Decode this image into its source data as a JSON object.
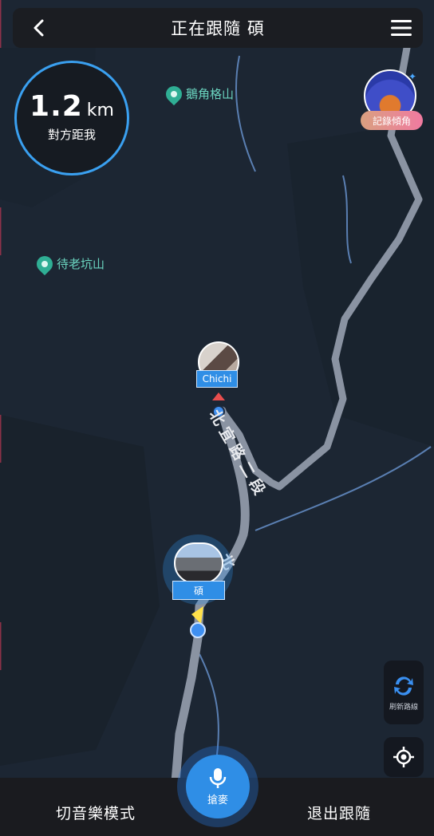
{
  "header": {
    "title": "正在跟隨 碩"
  },
  "distance": {
    "value": "1.2",
    "unit": "km",
    "label": "對方距我"
  },
  "pois": [
    {
      "label": "鵝角格山"
    },
    {
      "label": "待老坑山"
    }
  ],
  "record": {
    "label": "記錄傾角"
  },
  "riders": [
    {
      "name": "Chichi"
    },
    {
      "name": "碩"
    }
  ],
  "road": {
    "label1": "北宜路二段",
    "label2": "北"
  },
  "side_buttons": {
    "refresh_label": "刷新路線"
  },
  "bottom": {
    "left_label": "切音樂模式",
    "mic_label": "搶麥",
    "right_label": "退出跟隨"
  },
  "colors": {
    "accent": "#2f8ee6",
    "poi": "#6ad4bf",
    "route_ring": "#3aa0f0"
  }
}
